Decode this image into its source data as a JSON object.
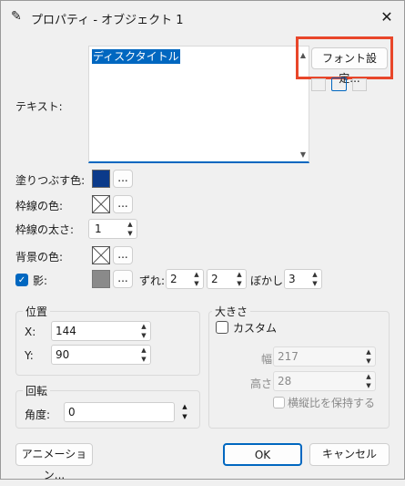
{
  "dialog": {
    "title": "プロパティ - オブジェクト 1",
    "close": "✕"
  },
  "text": {
    "label": "テキスト:",
    "value": "ディスクタイトル",
    "font_button": "フォント設定..."
  },
  "fill": {
    "label": "塗りつぶす色:",
    "btn": "..."
  },
  "border_color": {
    "label": "枠線の色:",
    "btn": "..."
  },
  "border_width": {
    "label": "枠線の太さ:",
    "value": "1"
  },
  "bg_color": {
    "label": "背景の色:",
    "btn": "..."
  },
  "shadow": {
    "label": "影:",
    "btn": "...",
    "offset_label": "ずれ:",
    "offset_x": "2",
    "offset_y": "2",
    "blur_label": "ぼかし:",
    "blur": "3"
  },
  "position": {
    "title": "位置",
    "x_label": "X:",
    "x": "144",
    "y_label": "Y:",
    "y": "90"
  },
  "rotation": {
    "title": "回転",
    "angle_label": "角度:",
    "angle": "0"
  },
  "size": {
    "title": "大きさ",
    "custom_label": "カスタム",
    "width_label": "幅:",
    "width": "217",
    "height_label": "高さ:",
    "height": "28",
    "aspect_label": "横縦比を保持する"
  },
  "footer": {
    "animation": "アニメーション...",
    "ok": "OK",
    "cancel": "キャンセル"
  },
  "colors": {
    "fill": "#0b3a8a",
    "accent": "#0067c0",
    "highlight": "#e8462a"
  }
}
